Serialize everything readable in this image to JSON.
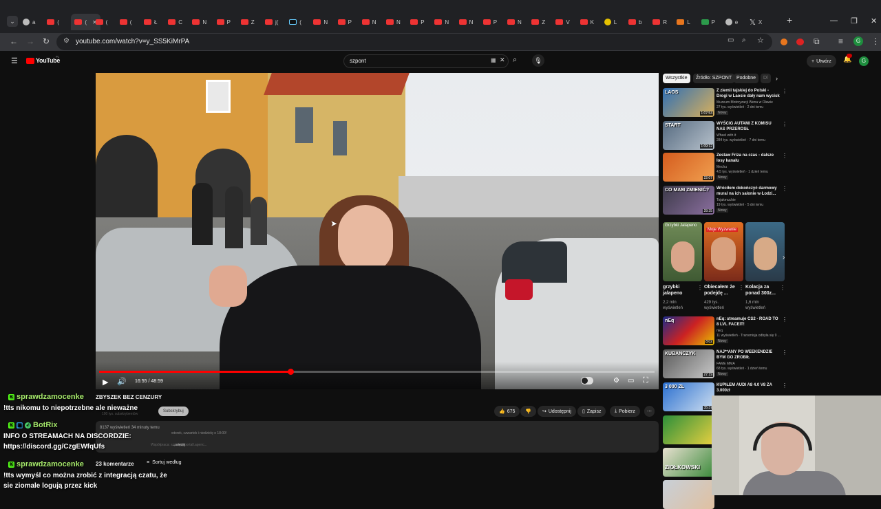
{
  "browser": {
    "url": "youtube.com/watch?v=y_SS5KiMrPA",
    "tabs": [
      {
        "icon": "g",
        "label": "a"
      },
      {
        "icon": "yt",
        "label": "("
      },
      {
        "icon": "yt",
        "label": "(",
        "active": true
      },
      {
        "icon": "yt",
        "label": "("
      },
      {
        "icon": "yt",
        "label": "("
      },
      {
        "icon": "yt",
        "label": "Ł"
      },
      {
        "icon": "yt",
        "label": "C"
      },
      {
        "icon": "yt",
        "label": "N"
      },
      {
        "icon": "yt",
        "label": "P"
      },
      {
        "icon": "yt",
        "label": "Z"
      },
      {
        "icon": "yt",
        "label": "j("
      },
      {
        "icon": "tk",
        "label": "("
      },
      {
        "icon": "yt",
        "label": "N"
      },
      {
        "icon": "yt",
        "label": "P"
      },
      {
        "icon": "yt",
        "label": "N"
      },
      {
        "icon": "yt",
        "label": "N"
      },
      {
        "icon": "yt",
        "label": "P"
      },
      {
        "icon": "yt",
        "label": "N"
      },
      {
        "icon": "yt",
        "label": "N"
      },
      {
        "icon": "yt",
        "label": "P"
      },
      {
        "icon": "yt",
        "label": "N"
      },
      {
        "icon": "yt",
        "label": "Z"
      },
      {
        "icon": "yt",
        "label": "V"
      },
      {
        "icon": "yt",
        "label": "K"
      },
      {
        "icon": "y",
        "label": "L"
      },
      {
        "icon": "yt",
        "label": "b"
      },
      {
        "icon": "yt",
        "label": "R"
      },
      {
        "icon": "o",
        "label": "L"
      },
      {
        "icon": "gr",
        "label": "P"
      },
      {
        "icon": "g",
        "label": "e"
      },
      {
        "icon": "x",
        "label": "X"
      }
    ]
  },
  "youtube": {
    "logo": "YouTube",
    "logo_sup": "PL",
    "search_value": "szpont",
    "create_label": "Utwórz"
  },
  "player": {
    "time": "16:55 / 48:59",
    "progress": 0.345
  },
  "video": {
    "channel": "ZBYSZEK BEZ CENZURY",
    "subscribers": "100 tys. subskrybentów",
    "subscribe_label": "Subskrybuj",
    "likes": "675",
    "share_label": "Udostępnij",
    "save_label": "Zapisz",
    "download_label": "Pobierz",
    "views_time": "8137 wyświetleń  34 minuty temu",
    "desc_line1": "wtorek, czwartek i niedzielę o 18:00!",
    "desc_line2": "Współpraca: szpont@portall.agenc...",
    "more_label": "...więcej",
    "comments_count": "23 komentarze",
    "sort_label": "Sortuj według"
  },
  "sidebar": {
    "chips": [
      "Wszystkie",
      "Źródło: SZPONT",
      "Podobne",
      "Dl"
    ],
    "videos_top": [
      {
        "title": "Z ziemii tajskiej do Polski - Drogi w Laosie dały nam wycisk",
        "channel": "Muzeum Motoryzacji Wena w Oławie",
        "meta": "27 tys. wyświetleń · 2 dni temu",
        "badge": "Nowy",
        "duration": "1:07:54"
      },
      {
        "title": "WYŚCIG AUTAMI Z KOMISU NAS PRZEROSŁ",
        "channel": "Wheel with it",
        "meta": "284 tys. wyświetleń · 7 dni temu",
        "badge": "",
        "duration": "1:09:12"
      },
      {
        "title": "Zestaw Friza na czas - dalsze losy kanału",
        "channel": "Mechu",
        "meta": "4,5 tys. wyświetleń · 1 dzień temu",
        "badge": "Nowy",
        "duration": "22:07"
      },
      {
        "title": "Wróciłem dokończyć darmowy mural na ich salonie w Łodzi...",
        "channel": "Tojakmuchie",
        "meta": "19 tys. wyświetleń · 5 dni temu",
        "badge": "Nowy",
        "duration": "28:35"
      }
    ],
    "shorts": [
      {
        "title": "grzybki jalapeno",
        "meta": "2,2 mln wyświetleń",
        "caption": "Grzybki Jalapeno"
      },
      {
        "title": "Obiecałem że podejdę ...",
        "meta": "429 tys. wyświetleń",
        "caption": "Moje Wyzwanie"
      },
      {
        "title": "Kolacja za ponad 300z...",
        "meta": "1,6 mln wyświetleń",
        "caption": ""
      }
    ],
    "videos_bottom": [
      {
        "title": "nEq: streamuje CS2 - ROAD TO 8 LVL FACEIT!",
        "channel": "nEq",
        "meta": "11 wyświetleń · Transmisja odbyła się 9 ...",
        "badge": "Nowy",
        "duration": "8:02"
      },
      {
        "title": "NAJ**ANY PO WEEKENDZIE BYM GO ZROBIŁ",
        "channel": "FAME MMA",
        "meta": "68 tys. wyświetleń · 1 dzień temu",
        "badge": "Nowy",
        "duration": "27:19"
      },
      {
        "title": "KUPIŁEM AUDI A8 4.0 V8 ZA 3.000zł",
        "channel": "",
        "meta": "",
        "badge": "",
        "duration": "35:37"
      }
    ]
  },
  "thumb_texts": {
    "laos": "LAOS",
    "start": "START",
    "pokazujemy": "POKAZUJEMY",
    "mamzmienic": "CO MAM ZMIENIĆ?",
    "neq": "nEq",
    "kubanczyk": "KUBANCZYK",
    "price": "3 000 ZŁ",
    "ziolkowski": "ZIOŁKOWSKI"
  },
  "chat": [
    {
      "user": "sprawdzamocenke",
      "message": "!tts nikomu to niepotrzebne ale nieważne"
    },
    {
      "user": "BotRix",
      "message": "INFO O STREAMACH NA DISCORDZIE:\nhttps://discord.gg/CzgEWfqUfs"
    },
    {
      "user": "sprawdzamocenke",
      "message": "!tts wymyśl co można zrobić z integracją czatu, że\nsie ziomale logują przez kick"
    }
  ],
  "colors": {
    "accent": "#ff0000",
    "chat_name": "#a6e96b",
    "kick": "#53fc18"
  }
}
